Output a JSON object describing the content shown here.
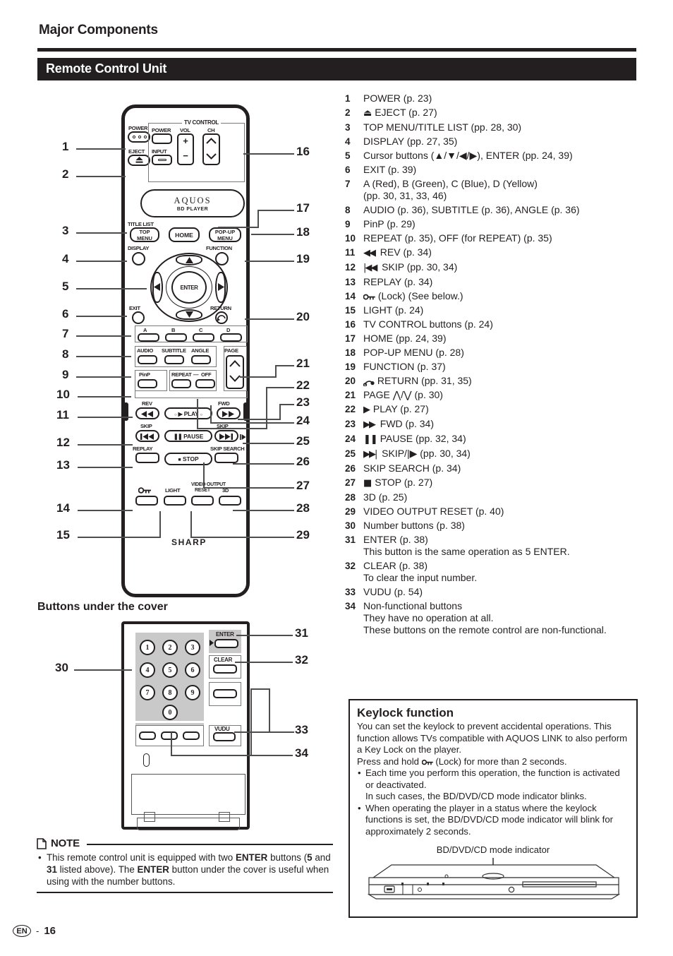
{
  "header": {
    "section_title": "Major Components",
    "bar_title": "Remote Control Unit"
  },
  "remote": {
    "brand": "AQUOS",
    "brand_sub": "BD  PLAYER",
    "maker": "SHARP",
    "tv_control_caption": "TV CONTROL",
    "labels": {
      "power": "POWER",
      "eject": "EJECT",
      "tv_power": "POWER",
      "tv_vol": "VOL",
      "tv_ch": "CH",
      "tv_input": "INPUT",
      "vol_plus": "+",
      "vol_minus": "−",
      "title_list": "TITLE LIST",
      "top_menu_l1": "TOP",
      "top_menu_l2": "MENU",
      "home": "HOME",
      "popup_l1": "POP-UP",
      "popup_l2": "MENU",
      "display": "DISPLAY",
      "function": "FUNCTION",
      "enter": "ENTER",
      "exit": "EXIT",
      "return": "RETURN",
      "a": "A",
      "b": "B",
      "c": "C",
      "d": "D",
      "audio": "AUDIO",
      "subtitle": "SUBTITLE",
      "angle": "ANGLE",
      "page": "PAGE",
      "pinp": "PinP",
      "repeat": "REPEAT",
      "repeat_dash": "—",
      "off": "OFF",
      "rev": "REV",
      "fwd": "FWD",
      "play": "PLAY",
      "skip_left": "SKIP",
      "skip_right": "SKIP",
      "pause": "PAUSE",
      "replay": "REPLAY",
      "skip_search": "SKIP SEARCH",
      "stop": "STOP",
      "lock": "lock-key-icon",
      "light": "LIGHT",
      "video_output_l1": "VIDEO OUTPUT",
      "video_output_l2": "RESET",
      "three_d": "3D"
    },
    "callouts_left": [
      "1",
      "2",
      "3",
      "4",
      "5",
      "6",
      "7",
      "8",
      "9",
      "10",
      "11",
      "12",
      "13",
      "14",
      "15"
    ],
    "callouts_right": [
      "16",
      "17",
      "18",
      "19",
      "20",
      "21",
      "22",
      "23",
      "24",
      "25",
      "26",
      "27",
      "28",
      "29"
    ]
  },
  "under_cover": {
    "title": "Buttons under the cover",
    "numbers": [
      "1",
      "2",
      "3",
      "4",
      "5",
      "6",
      "7",
      "8",
      "9",
      "0"
    ],
    "enter": "ENTER",
    "clear": "CLEAR",
    "vudu": "VUDU",
    "callouts": [
      "30",
      "31",
      "32",
      "33",
      "34"
    ]
  },
  "items": [
    {
      "n": "1",
      "text": "POWER (p. 23)"
    },
    {
      "n": "2",
      "icon": "eject-icon",
      "glyph": "⏏",
      "text": "EJECT (p. 27)"
    },
    {
      "n": "3",
      "text": "TOP MENU/TITLE LIST (pp. 28, 30)"
    },
    {
      "n": "4",
      "text": "DISPLAY (pp. 27, 35)"
    },
    {
      "n": "5",
      "text": "Cursor buttons (▲/▼/◀/▶), ENTER (pp. 24, 39)"
    },
    {
      "n": "6",
      "text": "EXIT (p. 39)"
    },
    {
      "n": "7",
      "text": "A (Red), B (Green), C (Blue), D (Yellow)",
      "sub": "(pp. 30, 31, 33, 46)"
    },
    {
      "n": "8",
      "text": "AUDIO (p. 36), SUBTITLE (p. 36), ANGLE (p. 36)"
    },
    {
      "n": "9",
      "text": "PinP (p. 29)"
    },
    {
      "n": "10",
      "text": "REPEAT (p. 35), OFF (for REPEAT) (p. 35)"
    },
    {
      "n": "11",
      "icon": "rewind-icon",
      "glyph": "◀◀",
      "text": "REV (p. 34)"
    },
    {
      "n": "12",
      "icon": "skip-back-icon",
      "glyph": "|◀◀",
      "text": "SKIP (pp. 30, 34)"
    },
    {
      "n": "13",
      "text": "REPLAY (p. 34)"
    },
    {
      "n": "14",
      "icon": "lock-key-icon",
      "glyph": "⚿",
      "text": "(Lock) (See below.)"
    },
    {
      "n": "15",
      "text": "LIGHT (p. 24)"
    },
    {
      "n": "16",
      "text": "TV CONTROL buttons (p. 24)"
    },
    {
      "n": "17",
      "text": "HOME (pp. 24, 39)"
    },
    {
      "n": "18",
      "text": "POP-UP MENU (p. 28)"
    },
    {
      "n": "19",
      "text": "FUNCTION (p. 37)"
    },
    {
      "n": "20",
      "icon": "return-arrow-icon",
      "glyph": "↩",
      "text": "RETURN (pp. 31, 35)"
    },
    {
      "n": "21",
      "text": "PAGE ⋀/⋁ (p. 30)"
    },
    {
      "n": "22",
      "icon": "play-icon",
      "glyph": "▶",
      "text": "PLAY (p. 27)"
    },
    {
      "n": "23",
      "icon": "fast-forward-icon",
      "glyph": "▶▶",
      "text": "FWD (p. 34)"
    },
    {
      "n": "24",
      "icon": "pause-icon",
      "glyph": "❚❚",
      "text": "PAUSE (pp. 32, 34)"
    },
    {
      "n": "25",
      "icon": "skip-forward-icon",
      "glyph": "▶▶|",
      "text": "SKIP/|▶ (pp. 30, 34)"
    },
    {
      "n": "26",
      "text": "SKIP SEARCH (p. 34)"
    },
    {
      "n": "27",
      "icon": "stop-icon",
      "glyph": "■",
      "text": "STOP (p. 27)"
    },
    {
      "n": "28",
      "text": "3D (p. 25)"
    },
    {
      "n": "29",
      "text": "VIDEO OUTPUT RESET (p. 40)"
    },
    {
      "n": "30",
      "text": "Number buttons (p. 38)"
    },
    {
      "n": "31",
      "text": "ENTER (p. 38)",
      "sub": "This button is the same operation as 5 ENTER."
    },
    {
      "n": "32",
      "text": "CLEAR (p. 38)",
      "sub": "To clear the input number."
    },
    {
      "n": "33",
      "text": "VUDU (p. 54)"
    },
    {
      "n": "34",
      "text": "Non-functional buttons",
      "sub": "They have no operation at all.",
      "sub2": "These buttons on the remote control are non-functional."
    }
  ],
  "keylock": {
    "title": "Keylock function",
    "p1": "You can set the keylock to prevent accidental operations. This function allows TVs compatible with AQUOS LINK to also perform a Key Lock on the player.",
    "p2_pre": "Press and hold",
    "p2_post": "(Lock) for more than 2 seconds.",
    "bullets": [
      {
        "line1": "Each time you perform this operation, the function is activated or deactivated.",
        "line2": "In such cases, the BD/DVD/CD mode indicator blinks."
      },
      {
        "line1": "When operating the player in a status where the keylock functions is set, the BD/DVD/CD mode indicator will blink for approximately 2 seconds."
      }
    ],
    "caption": "BD/DVD/CD mode indicator"
  },
  "note": {
    "label": "NOTE",
    "body_1": "This remote control unit is equipped with two ",
    "bold_1": "ENTER",
    "body_2": " buttons (",
    "bold_2": "5",
    "body_3": " and ",
    "bold_3": "31",
    "body_4": " listed above). The ",
    "bold_4": "ENTER",
    "body_5": " button under the cover is useful when using with the number buttons."
  },
  "footer": {
    "lang": "EN",
    "dash": "-",
    "page": "16"
  }
}
